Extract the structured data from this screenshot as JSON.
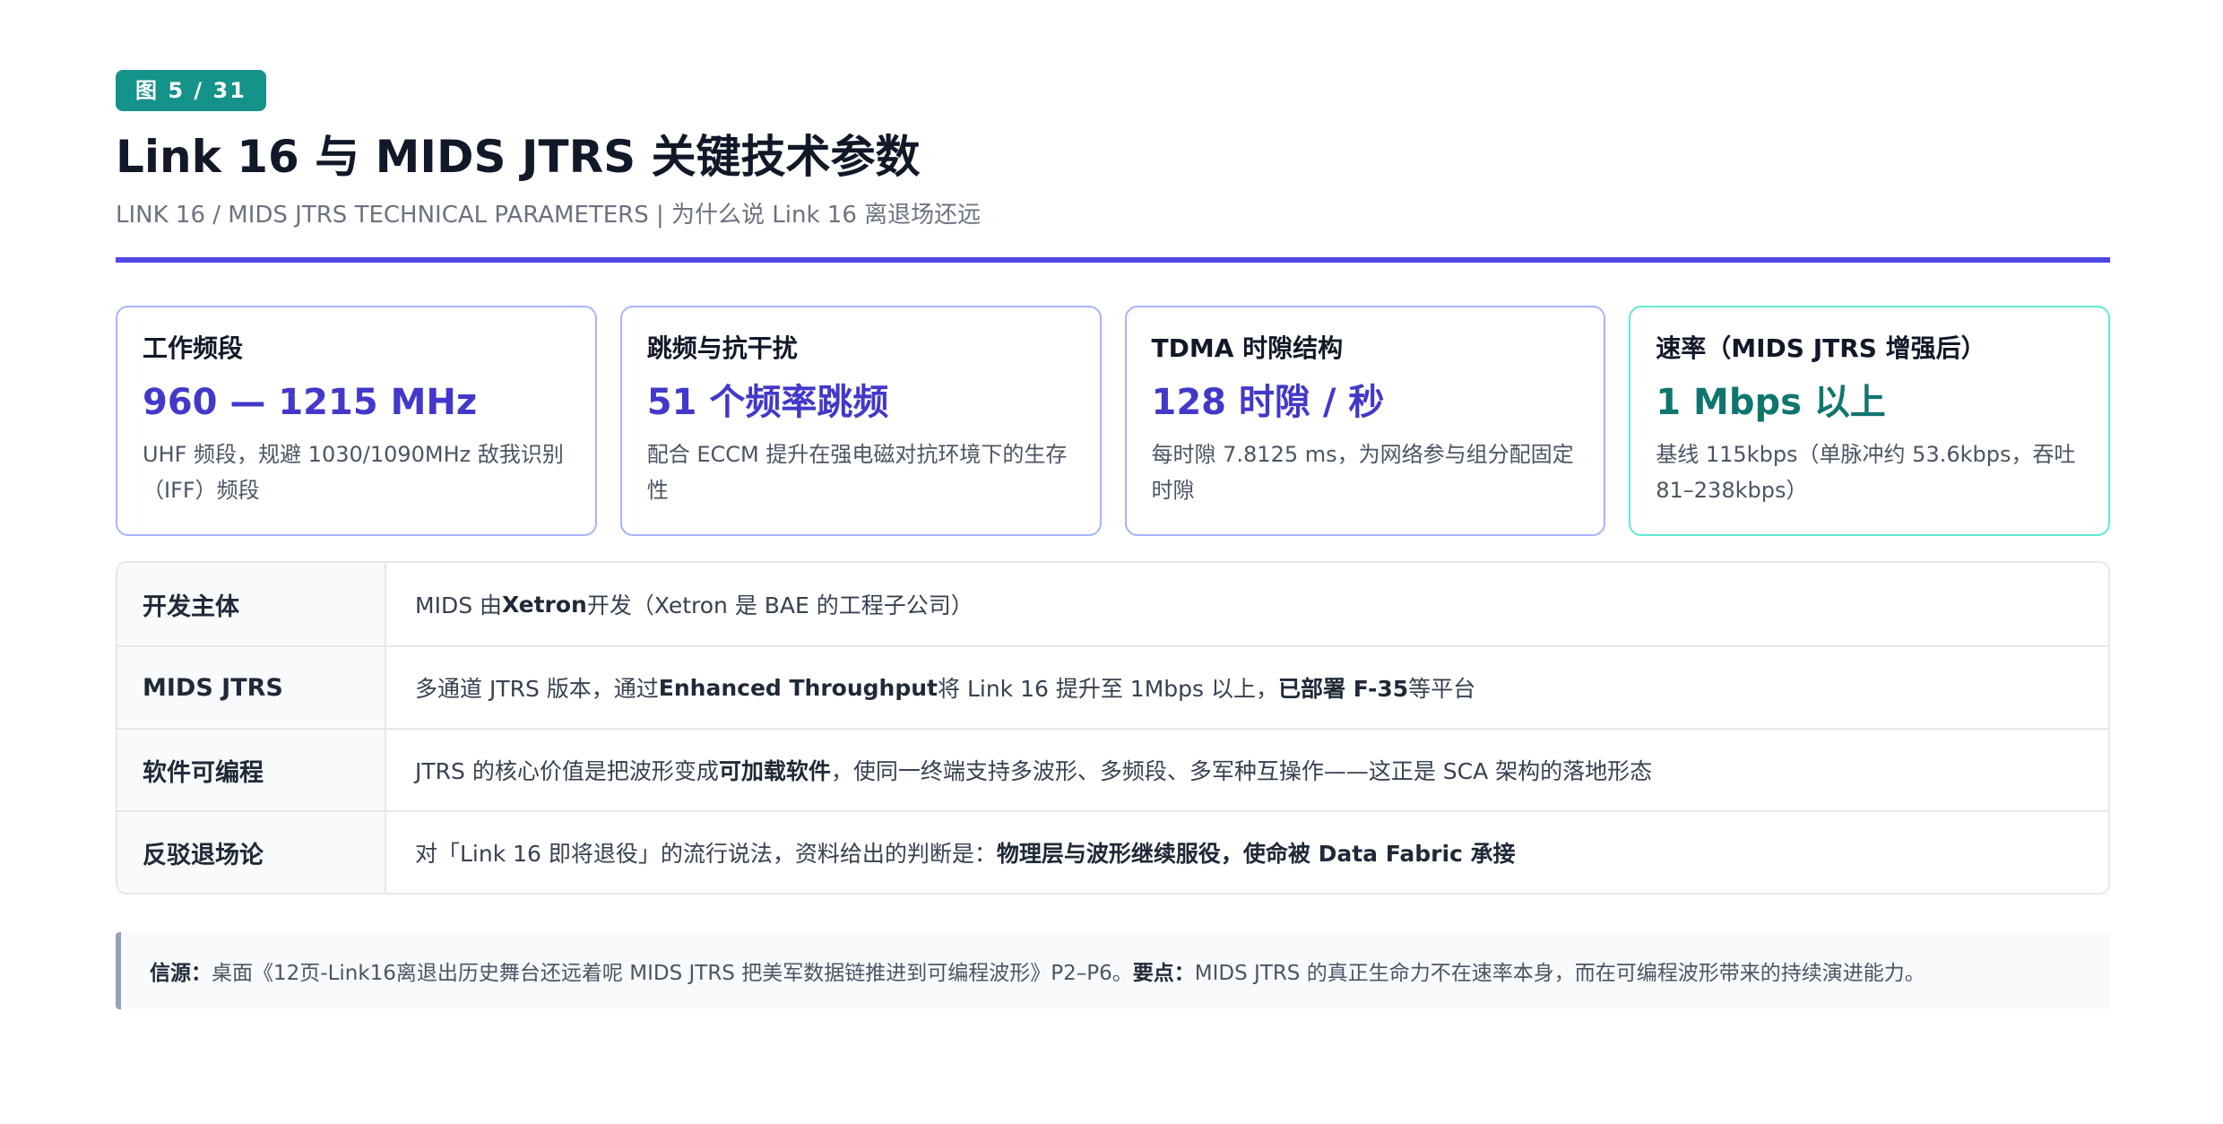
{
  "header": {
    "badge": "图 5 / 31",
    "title": "Link 16 与 MIDS JTRS 关键技术参数",
    "subtitle": "LINK 16 / MIDS JTRS TECHNICAL PARAMETERS | 为什么说 Link 16 离退场还远"
  },
  "cards": [
    {
      "label": "工作频段",
      "value": "960 — 1215 MHz",
      "desc": "UHF 频段，规避 1030/1090MHz 敌我识别（IFF）频段"
    },
    {
      "label": "跳频与抗干扰",
      "value": "51 个频率跳频",
      "desc": "配合 ECCM 提升在强电磁对抗环境下的生存性"
    },
    {
      "label": "TDMA 时隙结构",
      "value": "128 时隙 / 秒",
      "desc": "每时隙 7.8125 ms，为网络参与组分配固定时隙"
    },
    {
      "label": "速率（MIDS JTRS 增强后）",
      "value": "1 Mbps 以上",
      "desc": "基线 115kbps（单脉冲约 53.6kbps，吞吐 81–238kbps）"
    }
  ],
  "table": {
    "rows": [
      {
        "head": "开发主体",
        "pre": "MIDS 由 ",
        "bold": "Xetron",
        "post": " 开发（Xetron 是 BAE 的工程子公司）",
        "bold2": "",
        "post2": ""
      },
      {
        "head": "MIDS JTRS",
        "pre": "多通道 JTRS 版本，通过 ",
        "bold": "Enhanced Throughput",
        "post": " 将 Link 16 提升至 1Mbps 以上，",
        "bold2": "已部署 F-35",
        "post2": " 等平台"
      },
      {
        "head": "软件可编程",
        "pre": "JTRS 的核心价值是把波形变成",
        "bold": "可加载软件",
        "post": "，使同一终端支持多波形、多频段、多军种互操作——这正是 SCA 架构的落地形态",
        "bold2": "",
        "post2": ""
      },
      {
        "head": "反驳退场论",
        "pre": "对「Link 16 即将退役」的流行说法，资料给出的判断是：",
        "bold": "物理层与波形继续服役，使命被 Data Fabric 承接",
        "post": "",
        "bold2": "",
        "post2": ""
      }
    ]
  },
  "note": {
    "source_label": "信源：",
    "source_text": "桌面《12页-Link16离退出历史舞台还远着呢 MIDS JTRS 把美军数据链推进到可编程波形》P2–P6。",
    "key_label": "要点：",
    "key_text": "MIDS JTRS 的真正生命力不在速率本身，而在可编程波形带来的持续演进能力。"
  }
}
